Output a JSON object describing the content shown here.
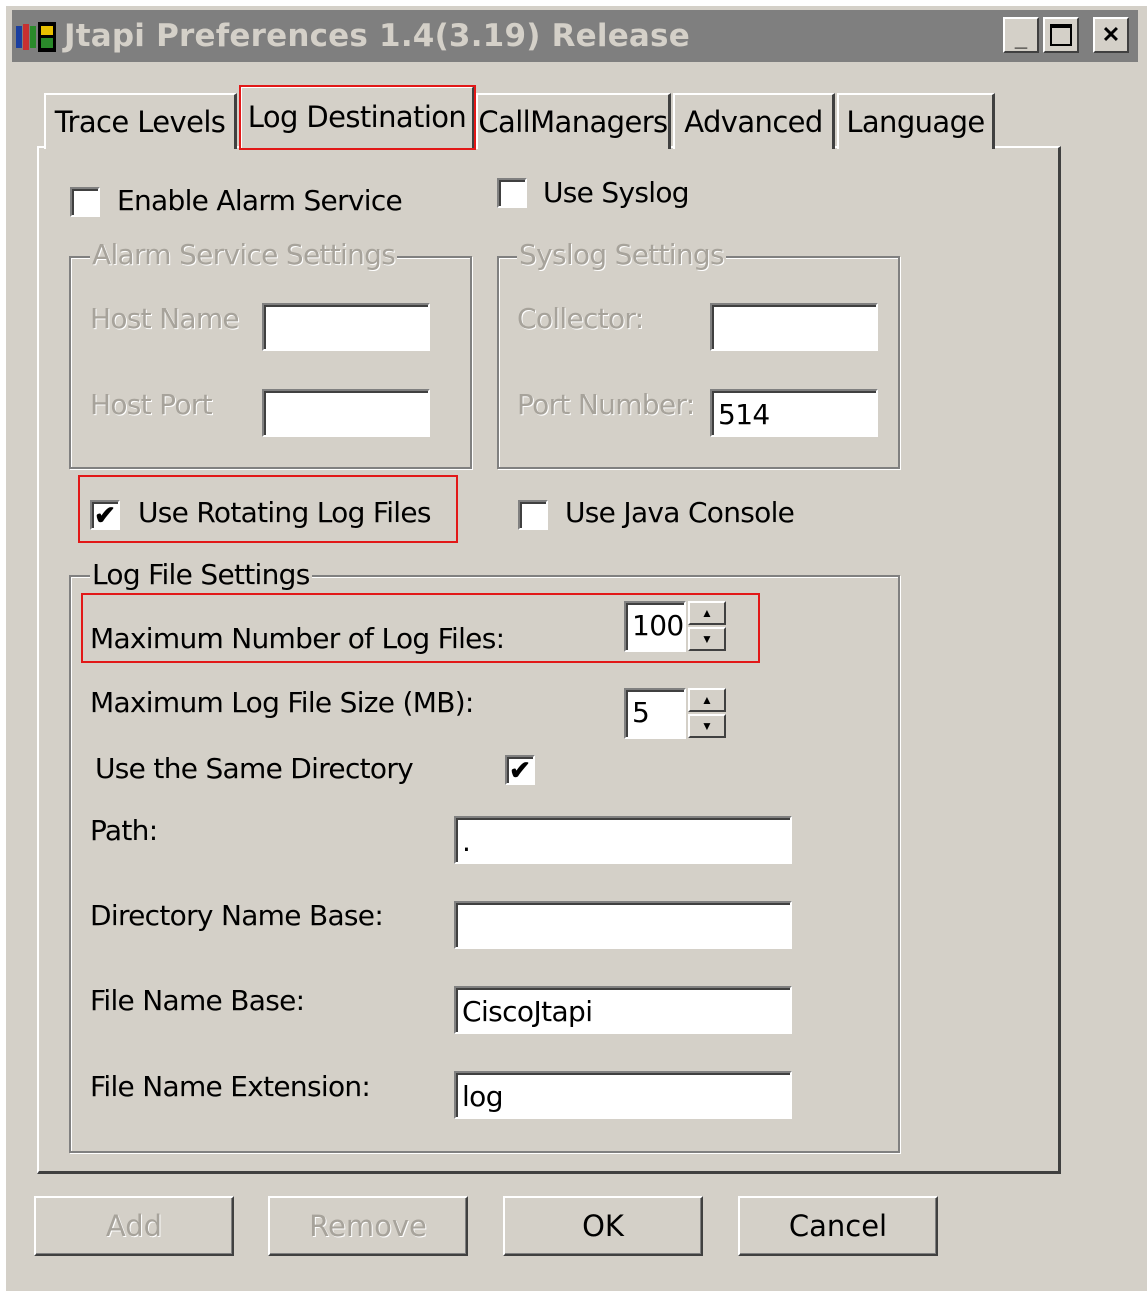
{
  "window": {
    "title": "Jtapi Preferences 1.4(3.19) Release",
    "app_icon": "cisco-app-icon",
    "controls": {
      "minimize": "_",
      "maximize": "□",
      "close": "✕"
    }
  },
  "tabs": [
    {
      "label": "Trace Levels"
    },
    {
      "label": "Log Destination",
      "active": true
    },
    {
      "label": "CallManagers"
    },
    {
      "label": "Advanced"
    },
    {
      "label": "Language"
    }
  ],
  "alarm": {
    "enable_label": "Enable Alarm Service",
    "enabled": false,
    "group_title": "Alarm Service Settings",
    "host_name_label": "Host Name",
    "host_name_value": "",
    "host_port_label": "Host Port",
    "host_port_value": ""
  },
  "syslog": {
    "use_label": "Use Syslog",
    "enabled": false,
    "group_title": "Syslog Settings",
    "collector_label": "Collector:",
    "collector_value": "",
    "port_label": "Port Number:",
    "port_value": "514"
  },
  "rotating": {
    "label": "Use Rotating Log Files",
    "checked": true,
    "check_glyph": "✔"
  },
  "java_console": {
    "label": "Use Java Console",
    "checked": false
  },
  "log_file": {
    "group_title": "Log File Settings",
    "max_files_label": "Maximum Number of Log Files:",
    "max_files_value": "100",
    "max_size_label": "Maximum Log File Size (MB):",
    "max_size_value": "5",
    "same_dir_label": "Use the Same Directory",
    "same_dir_checked": true,
    "path_label": "Path:",
    "path_value": ".",
    "dir_base_label": "Directory Name Base:",
    "dir_base_value": "",
    "file_base_label": "File Name Base:",
    "file_base_value": "CiscoJtapi",
    "file_ext_label": "File Name Extension:",
    "file_ext_value": "log"
  },
  "spinner": {
    "up": "▲",
    "down": "▼"
  },
  "buttons": {
    "add": "Add",
    "remove": "Remove",
    "ok": "OK",
    "cancel": "Cancel"
  },
  "colors": {
    "face": "#d4d0c8",
    "titlebar": "#7f7f7f",
    "highlight_box": "#e21818",
    "disabled_text": "#a7a39b"
  }
}
